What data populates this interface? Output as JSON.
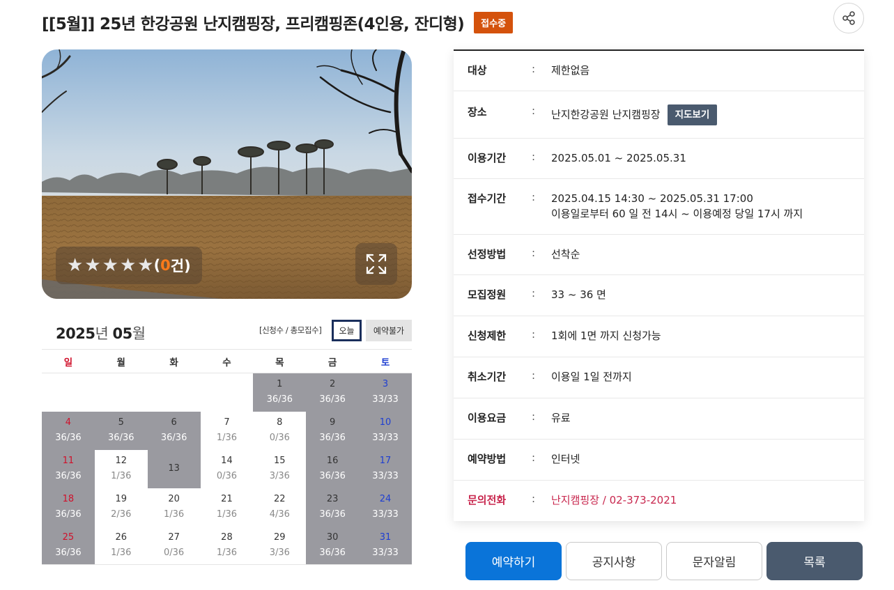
{
  "header": {
    "title": "[[5월]] 25년 한강공원 난지캠핑장, 프리캠핑존(4인용, 잔디형)",
    "status": "접수중",
    "share_icon": "share-icon"
  },
  "photo": {
    "rating_stars": 5,
    "rating_open": "(",
    "rating_count": "0",
    "rating_suffix": " 건)",
    "expand_icon": "expand-icon"
  },
  "calendar": {
    "year": "2025",
    "year_unit": "년 ",
    "month": "05",
    "month_unit": "월",
    "legend": "[신청수 / 총모집수]",
    "today_label": "오늘",
    "unavailable_label": "예약불가",
    "weekdays": [
      "일",
      "월",
      "화",
      "수",
      "목",
      "금",
      "토"
    ],
    "weeks": [
      [
        null,
        null,
        null,
        null,
        {
          "day": "1",
          "count": "36/36",
          "closed": true
        },
        {
          "day": "2",
          "count": "36/36",
          "closed": true
        },
        {
          "day": "3",
          "count": "33/33",
          "closed": true
        }
      ],
      [
        {
          "day": "4",
          "count": "36/36",
          "closed": true
        },
        {
          "day": "5",
          "count": "36/36",
          "closed": true
        },
        {
          "day": "6",
          "count": "36/36",
          "closed": true
        },
        {
          "day": "7",
          "count": "1/36",
          "closed": false
        },
        {
          "day": "8",
          "count": "0/36",
          "closed": false
        },
        {
          "day": "9",
          "count": "36/36",
          "closed": true
        },
        {
          "day": "10",
          "count": "33/33",
          "closed": true
        }
      ],
      [
        {
          "day": "11",
          "count": "36/36",
          "closed": true
        },
        {
          "day": "12",
          "count": "1/36",
          "closed": false
        },
        {
          "day": "13",
          "count": "",
          "closed": true
        },
        {
          "day": "14",
          "count": "0/36",
          "closed": false
        },
        {
          "day": "15",
          "count": "3/36",
          "closed": false
        },
        {
          "day": "16",
          "count": "36/36",
          "closed": true
        },
        {
          "day": "17",
          "count": "33/33",
          "closed": true
        }
      ],
      [
        {
          "day": "18",
          "count": "36/36",
          "closed": true
        },
        {
          "day": "19",
          "count": "2/36",
          "closed": false
        },
        {
          "day": "20",
          "count": "1/36",
          "closed": false
        },
        {
          "day": "21",
          "count": "1/36",
          "closed": false
        },
        {
          "day": "22",
          "count": "4/36",
          "closed": false
        },
        {
          "day": "23",
          "count": "36/36",
          "closed": true
        },
        {
          "day": "24",
          "count": "33/33",
          "closed": true
        }
      ],
      [
        {
          "day": "25",
          "count": "36/36",
          "closed": true
        },
        {
          "day": "26",
          "count": "1/36",
          "closed": false
        },
        {
          "day": "27",
          "count": "0/36",
          "closed": false
        },
        {
          "day": "28",
          "count": "1/36",
          "closed": false
        },
        {
          "day": "29",
          "count": "3/36",
          "closed": false
        },
        {
          "day": "30",
          "count": "36/36",
          "closed": true
        },
        {
          "day": "31",
          "count": "33/33",
          "closed": true
        }
      ]
    ]
  },
  "info": {
    "separator": ":",
    "rows": [
      {
        "label": "대상",
        "value": "제한없음"
      },
      {
        "label": "장소",
        "value": "난지한강공원 난지캠핑장",
        "button": "지도보기"
      },
      {
        "label": "이용기간",
        "value": "2025.05.01 ~ 2025.05.31"
      },
      {
        "label": "접수기간",
        "value": "2025.04.15 14:30 ~ 2025.05.31 17:00",
        "value2": "이용일로부터 60 일 전 14시 ~ 이용예정 당일 17시 까지"
      },
      {
        "label": "선정방법",
        "value": "선착순"
      },
      {
        "label": "모집정원",
        "value": "33 ~ 36 면"
      },
      {
        "label": "신청제한",
        "value": "1회에 1면 까지 신청가능"
      },
      {
        "label": "취소기간",
        "value": "이용일 1일 전까지"
      },
      {
        "label": "이용요금",
        "value": "유료"
      },
      {
        "label": "예약방법",
        "value": "인터넷"
      },
      {
        "label": "문의전화",
        "value": "난지캠핑장 / 02-373-2021"
      }
    ]
  },
  "actions": {
    "reserve": "예약하기",
    "notice": "공지사항",
    "sms": "문자알림",
    "list": "목록"
  },
  "colors": {
    "status_badge": "#d4520c",
    "reserve_button": "#0a74d9",
    "dark_button": "#4a5a6e",
    "closed_cell": "#9a9aa0",
    "sunday": "#d0112b",
    "saturday": "#1f3fd1",
    "contact": "#c8264d"
  }
}
